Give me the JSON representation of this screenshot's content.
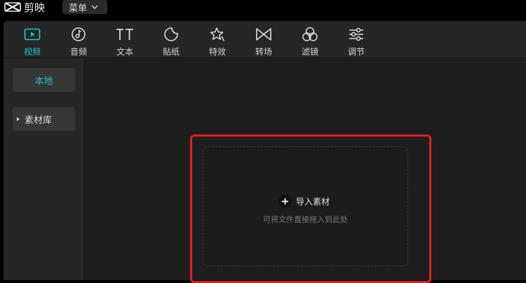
{
  "app": {
    "title": "剪映",
    "menu_label": "菜单"
  },
  "toolbar": {
    "tabs": [
      {
        "label": "视频",
        "icon": "video-icon",
        "active": true
      },
      {
        "label": "音频",
        "icon": "music-icon",
        "active": false
      },
      {
        "label": "文本",
        "icon": "text-icon",
        "active": false
      },
      {
        "label": "贴纸",
        "icon": "sticker-icon",
        "active": false
      },
      {
        "label": "特效",
        "icon": "effects-icon",
        "active": false
      },
      {
        "label": "转场",
        "icon": "transition-icon",
        "active": false
      },
      {
        "label": "滤镜",
        "icon": "filter-icon",
        "active": false
      },
      {
        "label": "调节",
        "icon": "adjust-icon",
        "active": false
      }
    ]
  },
  "sidebar": {
    "local": "本地",
    "library": "素材库"
  },
  "import": {
    "label": "导入素材",
    "hint": "可将文件直接拖入到此处"
  },
  "colors": {
    "accent": "#21c6cf",
    "highlight": "#e0201d"
  }
}
